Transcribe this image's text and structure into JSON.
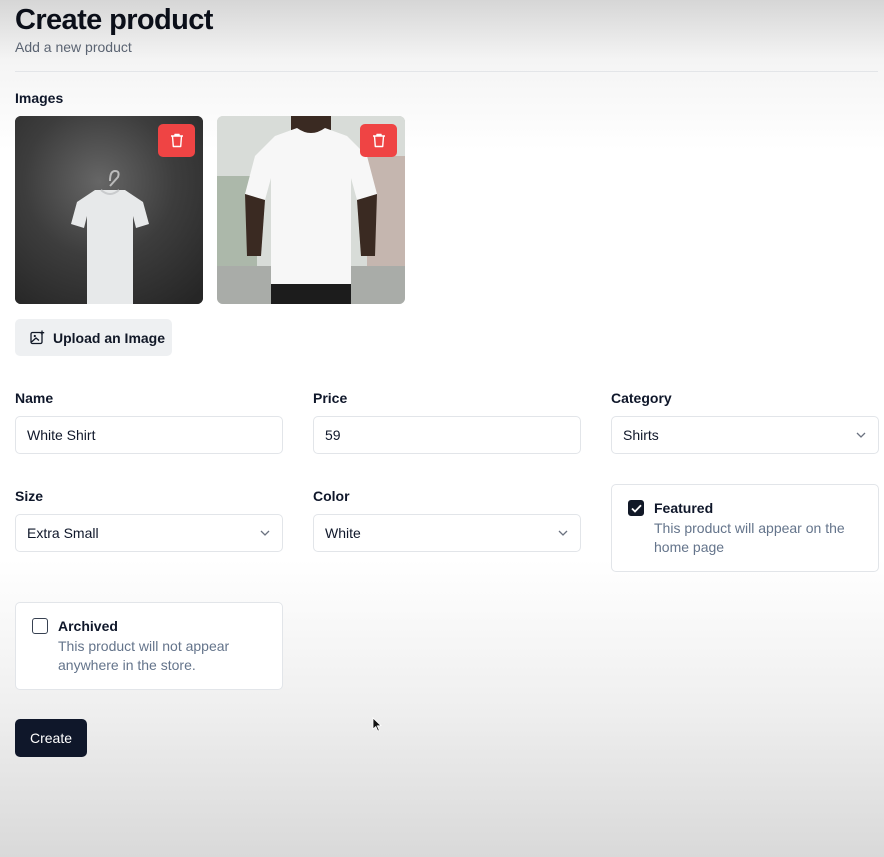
{
  "header": {
    "title": "Create product",
    "subtitle": "Add a new product"
  },
  "images": {
    "label": "Images",
    "items": [
      {
        "alt": "white t-shirt on hanger against dark wall",
        "delete_icon": "trash-icon"
      },
      {
        "alt": "person wearing white t-shirt",
        "delete_icon": "trash-icon"
      }
    ],
    "upload_label": "Upload an Image",
    "upload_icon": "image-plus-icon"
  },
  "form": {
    "name": {
      "label": "Name",
      "value": "White Shirt"
    },
    "price": {
      "label": "Price",
      "value": "59"
    },
    "category": {
      "label": "Category",
      "value": "Shirts"
    },
    "size": {
      "label": "Size",
      "value": "Extra Small"
    },
    "color": {
      "label": "Color",
      "value": "White"
    },
    "featured": {
      "title": "Featured",
      "description": "This product will appear on the home page",
      "checked": true
    },
    "archived": {
      "title": "Archived",
      "description": "This product will not appear anywhere in the store.",
      "checked": false
    }
  },
  "actions": {
    "create_label": "Create"
  },
  "colors": {
    "primary": "#0f172a",
    "danger": "#ef4444",
    "muted_text": "#64748b",
    "border": "#e2e5e9"
  }
}
